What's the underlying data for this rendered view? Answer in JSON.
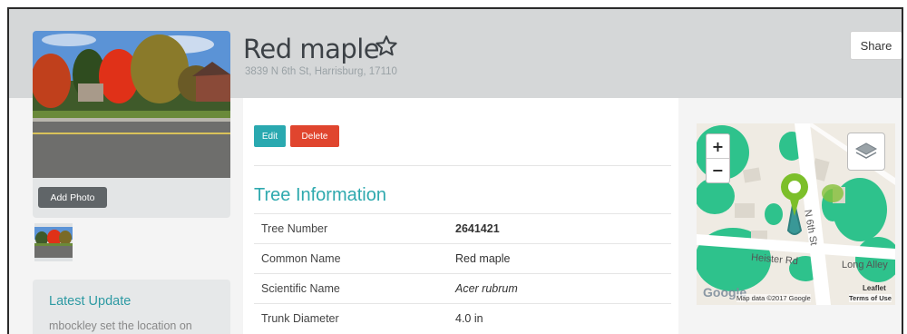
{
  "tree": {
    "name": "Red maple",
    "address": "3839 N 6th St, Harrisburg, 17110"
  },
  "header": {
    "share_label": "Share"
  },
  "photo": {
    "add_label": "Add Photo"
  },
  "latest_update": {
    "title": "Latest Update",
    "text": "mbockley set the location on"
  },
  "actions": {
    "edit_label": "Edit",
    "delete_label": "Delete"
  },
  "tree_info": {
    "title": "Tree Information",
    "rows": [
      {
        "label": "Tree Number",
        "value": "2641421"
      },
      {
        "label": "Common Name",
        "value": "Red maple"
      },
      {
        "label": "Scientific Name",
        "value": "Acer rubrum"
      },
      {
        "label": "Trunk Diameter",
        "value": "4.0 in"
      }
    ]
  },
  "map": {
    "zoom_in": "+",
    "zoom_out": "−",
    "streets": [
      "N 6th St",
      "Heister Rd",
      "Long Alley"
    ],
    "google_logo": "Google",
    "attribution": "Map data ©2017 Google",
    "terms": "Terms of Use",
    "leaflet": "Leaflet"
  },
  "colors": {
    "accent": "#2aa9b0",
    "danger": "#e0452e",
    "header_band": "#d5d7d8",
    "marker": "#7cbf2a"
  },
  "icons": {
    "favorite": "star-outline-icon",
    "layers": "layers-icon",
    "marker": "map-marker-icon"
  }
}
